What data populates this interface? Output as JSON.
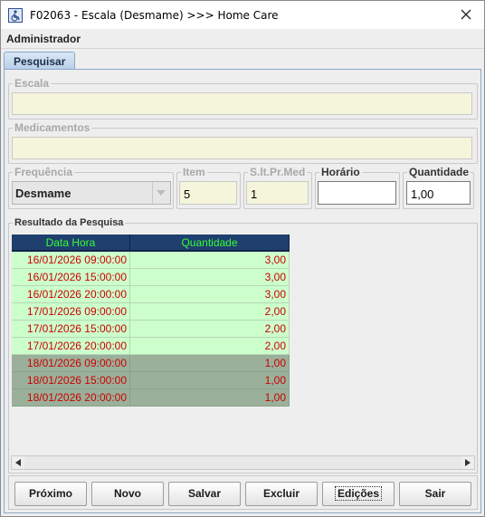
{
  "window": {
    "title": "F02063 - Escala (Desmame) >>> Home Care"
  },
  "user": {
    "name": "Administrador"
  },
  "tabs": [
    {
      "label": "Pesquisar"
    }
  ],
  "form": {
    "escala": {
      "label": "Escala",
      "value": ""
    },
    "medicamentos": {
      "label": "Medicamentos",
      "value": ""
    },
    "frequencia": {
      "label": "Frequência",
      "value": "Desmame"
    },
    "item": {
      "label": "Item",
      "value": "5"
    },
    "slt": {
      "label": "S.lt.Pr.Med",
      "value": "1"
    },
    "horario": {
      "label": "Horário",
      "value": ""
    },
    "quantidade": {
      "label": "Quantidade",
      "value": "1,00"
    }
  },
  "results": {
    "label": "Resultado da Pesquisa",
    "columns": [
      "Data Hora",
      "Quantidade"
    ],
    "rows": [
      {
        "datahora": "16/01/2026 09:00:00",
        "quantidade": "3,00",
        "style": "light"
      },
      {
        "datahora": "16/01/2026 15:00:00",
        "quantidade": "3,00",
        "style": "light"
      },
      {
        "datahora": "16/01/2026 20:00:00",
        "quantidade": "3,00",
        "style": "light"
      },
      {
        "datahora": "17/01/2026 09:00:00",
        "quantidade": "2,00",
        "style": "light"
      },
      {
        "datahora": "17/01/2026 15:00:00",
        "quantidade": "2,00",
        "style": "light"
      },
      {
        "datahora": "17/01/2026 20:00:00",
        "quantidade": "2,00",
        "style": "light"
      },
      {
        "datahora": "18/01/2026 09:00:00",
        "quantidade": "1,00",
        "style": "dark"
      },
      {
        "datahora": "18/01/2026 15:00:00",
        "quantidade": "1,00",
        "style": "dark"
      },
      {
        "datahora": "18/01/2026 20:00:00",
        "quantidade": "1,00",
        "style": "dark"
      }
    ]
  },
  "buttons": {
    "proximo": "Próximo",
    "novo": "Novo",
    "salvar": "Salvar",
    "excluir": "Excluir",
    "edicoes": "Edições",
    "sair": "Sair"
  },
  "colors": {
    "header_bg": "#1f3f6e",
    "header_text": "#33ff33",
    "row_light": "#ccffcc",
    "row_dark": "#9ab09a",
    "cell_text": "#cc0000",
    "readonly_field": "#f5f5dc"
  },
  "icons": {
    "app": "wheelchair-icon",
    "close": "close-icon",
    "dropdown": "chevron-down-icon",
    "scroll_left": "arrow-left-icon",
    "scroll_right": "arrow-right-icon"
  }
}
